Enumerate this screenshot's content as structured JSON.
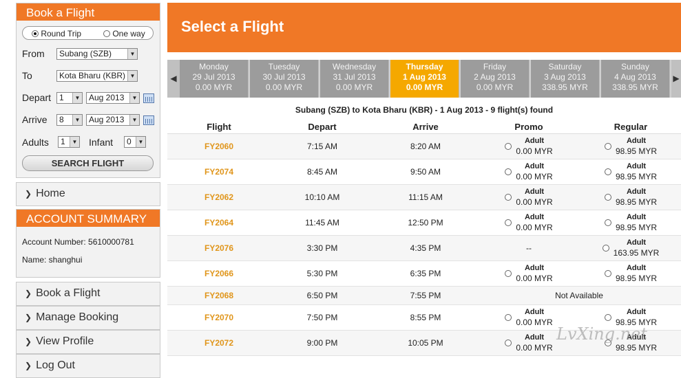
{
  "sidebar": {
    "book_title": "Book a Flight",
    "trip_round": "Round Trip",
    "trip_oneway": "One way",
    "from_label": "From",
    "from_value": "Subang (SZB)",
    "to_label": "To",
    "to_value": "Kota Bharu (KBR)",
    "depart_label": "Depart",
    "depart_day": "1",
    "depart_month": "Aug 2013",
    "arrive_label": "Arrive",
    "arrive_day": "8",
    "arrive_month": "Aug 2013",
    "adults_label": "Adults",
    "adults_value": "1",
    "infant_label": "Infant",
    "infant_value": "0",
    "search_label": "SEARCH FLIGHT",
    "home_label": "Home",
    "account_title": "ACCOUNT SUMMARY",
    "account_number": "Account Number: 5610000781",
    "account_name": "Name: shanghui",
    "nav": [
      "Book a Flight",
      "Manage Booking",
      "View Profile",
      "Log Out"
    ]
  },
  "main": {
    "title": "Select a Flight",
    "days": [
      {
        "weekday": "Monday",
        "date": "29 Jul 2013",
        "price": "0.00 MYR"
      },
      {
        "weekday": "Tuesday",
        "date": "30 Jul 2013",
        "price": "0.00 MYR"
      },
      {
        "weekday": "Wednesday",
        "date": "31 Jul 2013",
        "price": "0.00 MYR"
      },
      {
        "weekday": "Thursday",
        "date": "1 Aug 2013",
        "price": "0.00 MYR"
      },
      {
        "weekday": "Friday",
        "date": "2 Aug 2013",
        "price": "0.00 MYR"
      },
      {
        "weekday": "Saturday",
        "date": "3 Aug 2013",
        "price": "338.95 MYR"
      },
      {
        "weekday": "Sunday",
        "date": "4 Aug 2013",
        "price": "338.95 MYR"
      }
    ],
    "route_summary": "Subang (SZB) to Kota Bharu (KBR) - 1 Aug 2013 - 9 flight(s) found",
    "columns": [
      "Flight",
      "Depart",
      "Arrive",
      "Promo",
      "Regular"
    ],
    "fare_label": "Adult",
    "flights": [
      {
        "no": "FY2060",
        "dep": "7:15 AM",
        "arr": "8:20 AM",
        "promo": "0.00 MYR",
        "regular": "98.95 MYR"
      },
      {
        "no": "FY2074",
        "dep": "8:45 AM",
        "arr": "9:50 AM",
        "promo": "0.00 MYR",
        "regular": "98.95 MYR"
      },
      {
        "no": "FY2062",
        "dep": "10:10 AM",
        "arr": "11:15 AM",
        "promo": "0.00 MYR",
        "regular": "98.95 MYR"
      },
      {
        "no": "FY2064",
        "dep": "11:45 AM",
        "arr": "12:50 PM",
        "promo": "0.00 MYR",
        "regular": "98.95 MYR"
      },
      {
        "no": "FY2076",
        "dep": "3:30 PM",
        "arr": "4:35 PM",
        "promo_text": "--",
        "regular": "163.95 MYR"
      },
      {
        "no": "FY2066",
        "dep": "5:30 PM",
        "arr": "6:35 PM",
        "promo": "0.00 MYR",
        "regular": "98.95 MYR"
      },
      {
        "no": "FY2068",
        "dep": "6:50 PM",
        "arr": "7:55 PM",
        "unavailable": "Not Available"
      },
      {
        "no": "FY2070",
        "dep": "7:50 PM",
        "arr": "8:55 PM",
        "promo": "0.00 MYR",
        "regular": "98.95 MYR"
      },
      {
        "no": "FY2072",
        "dep": "9:00 PM",
        "arr": "10:05 PM",
        "promo": "0.00 MYR",
        "regular": "98.95 MYR"
      }
    ],
    "watermark": "LvXing.net"
  }
}
